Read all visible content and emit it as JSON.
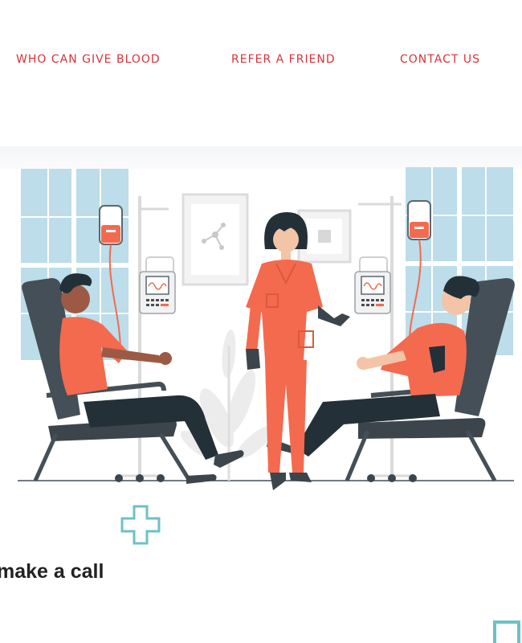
{
  "nav": {
    "items": [
      {
        "label": "WHO CAN GIVE BLOOD"
      },
      {
        "label": "REFER A FRIEND"
      },
      {
        "label": "CONTACT US"
      }
    ]
  },
  "hero": {
    "illustration_icon": "blood-donation-illustration"
  },
  "section": {
    "icon": "medical-cross-icon",
    "heading": "make a call"
  },
  "colors": {
    "nav_link": "#d6333b",
    "accent_teal": "#6cc2c4",
    "accent_coral": "#f46a4f",
    "window_blue": "#bcdde9",
    "chair_dark": "#454f57"
  }
}
